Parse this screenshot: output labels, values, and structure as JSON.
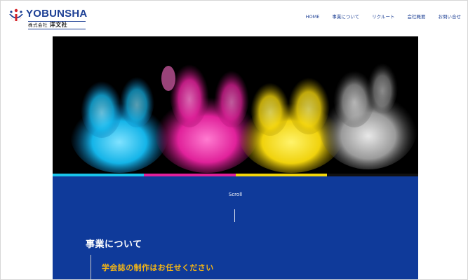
{
  "brand": {
    "name": "YOBUNSHA",
    "company_prefix": "株式会社",
    "company_name": "洋文社",
    "color_primary": "#1c3f94",
    "color_accent": "#d4242a"
  },
  "nav": {
    "items": [
      {
        "label": "HOME"
      },
      {
        "label": "事業について"
      },
      {
        "label": "リクルート"
      },
      {
        "label": "会社概要"
      },
      {
        "label": "お問い合せ"
      }
    ]
  },
  "hero": {
    "image": "colored-powder-explosion",
    "bar_colors": [
      "#19c4ea",
      "#e0219a",
      "#f2d60a",
      "#111111"
    ]
  },
  "main": {
    "background": "#0f3a9a",
    "scroll_label": "Scroll",
    "section_title": "事業について",
    "section_subtitle": "学会誌の制作はお任せください",
    "subtitle_color": "#f2b416"
  }
}
